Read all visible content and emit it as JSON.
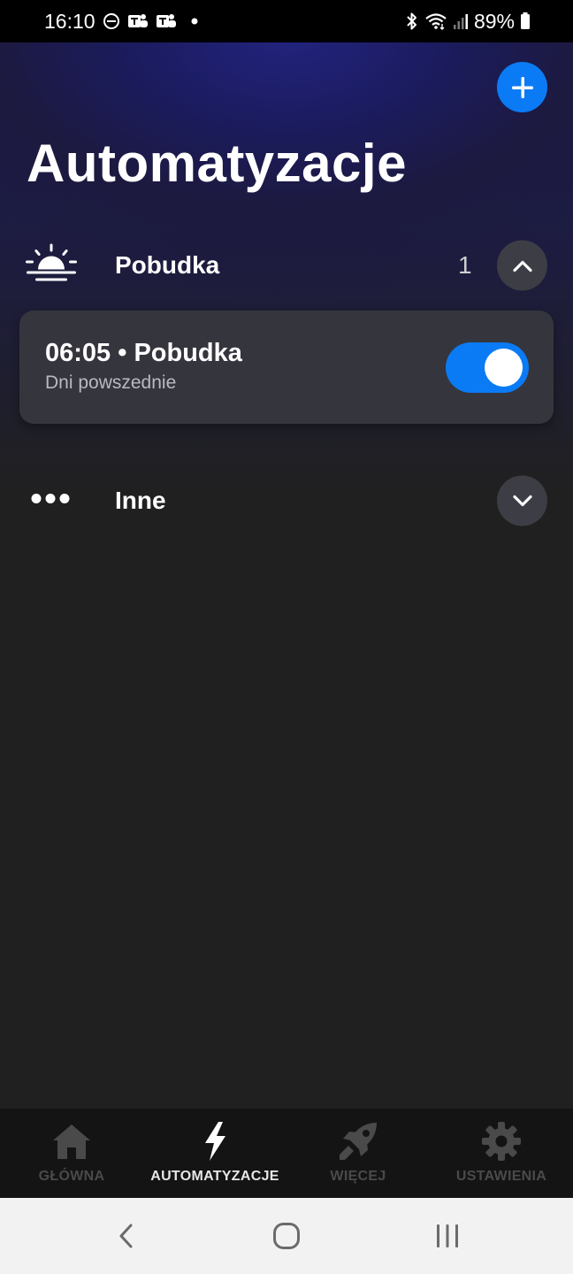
{
  "status_bar": {
    "time": "16:10",
    "battery": "89%",
    "icons": [
      "dnd-icon",
      "teams-icon",
      "teams-icon",
      "dot-icon",
      "bluetooth-icon",
      "wifi-icon",
      "signal-icon",
      "battery-icon"
    ]
  },
  "header": {
    "title": "Automatyzacje",
    "add_icon": "plus-icon"
  },
  "groups": [
    {
      "icon": "sunrise-icon",
      "label": "Pobudka",
      "count": "1",
      "expanded": true,
      "items": [
        {
          "title": "06:05 • Pobudka",
          "subtitle": "Dni powszednie",
          "enabled": true
        }
      ]
    },
    {
      "icon": "more-dots-icon",
      "label": "Inne",
      "expanded": false
    }
  ],
  "bottom_nav": {
    "active": "AUTOMATYZACJE",
    "items": [
      {
        "label": "GŁÓWNA",
        "icon": "home-icon"
      },
      {
        "label": "AUTOMATYZACJE",
        "icon": "lightning-icon"
      },
      {
        "label": "WIĘCEJ",
        "icon": "rocket-icon"
      },
      {
        "label": "USTAWIENIA",
        "icon": "gear-icon"
      }
    ]
  },
  "system_nav": {
    "icons": [
      "back-icon",
      "home-circle-icon",
      "recents-icon"
    ]
  },
  "colors": {
    "accent": "#0a7bf5",
    "background": "#202020",
    "card": "#35353d",
    "hero": "#1b1b5e",
    "nav_inactive": "#4a4a4a"
  }
}
